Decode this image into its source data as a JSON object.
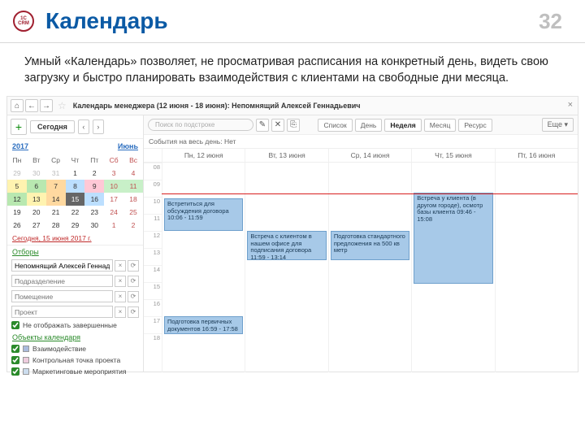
{
  "slide": {
    "title": "Календарь",
    "page_number": "32",
    "logo_top": "1C",
    "logo_bot": "CRM",
    "description": "Умный «Календарь» позволяет, не просматривая расписания на конкретный день, видеть свою загрузку и быстро планировать взаимодействия с клиентами на свободные дни месяца."
  },
  "app": {
    "title": "Календарь менеджера (12 июня - 18 июня): Непомнящий Алексей Геннадьевич",
    "today_button": "Сегодня",
    "year": "2017",
    "month": "Июнь",
    "dow": [
      "Пн",
      "Вт",
      "Ср",
      "Чт",
      "Пт",
      "Сб",
      "Вс"
    ],
    "today_date": "Сегодня, 15 июня 2017 г.",
    "views": {
      "list": "Список",
      "day": "День",
      "week": "Неделя",
      "month": "Месяц",
      "resource": "Ресурс",
      "more": "Еще"
    },
    "search_placeholder": "Поиск по подстроке",
    "allday": "События на весь день: Нет",
    "days": [
      "Пн, 12 июня",
      "Вт, 13 июня",
      "Ср, 14 июня",
      "Чт, 15 июня",
      "Пт, 16 июня"
    ],
    "filters_label": "Отборы",
    "filter1_value": "Непомнящий Алексей Геннады",
    "filter2_placeholder": "Подразделение",
    "filter3_placeholder": "Помещение",
    "filter4_placeholder": "Проект",
    "chk_hide": "Не отображать завершенные",
    "objects_label": "Объекты календаря",
    "obj1": "Взаимодействие",
    "obj2": "Контрольная точка проекта",
    "obj3": "Маркетинговые мероприятия",
    "events": {
      "e1": "Встретиться для обсуждения договора 10:06 - 11:59",
      "e2": "Встреча с клиентом в нашем офисе для подписания договора 11:59 - 13:14",
      "e3": "Подготовка стандартного предложения на 500 кв метр",
      "e4": "Встреча у клиента (в другом городе), осмотр базы клиента 09:46 - 15:08",
      "e5": "Подготовка первичных документов 16:59 - 17:58"
    },
    "hours": [
      "08",
      "09",
      "10",
      "11",
      "12",
      "13",
      "14",
      "15",
      "16",
      "17",
      "18"
    ]
  }
}
